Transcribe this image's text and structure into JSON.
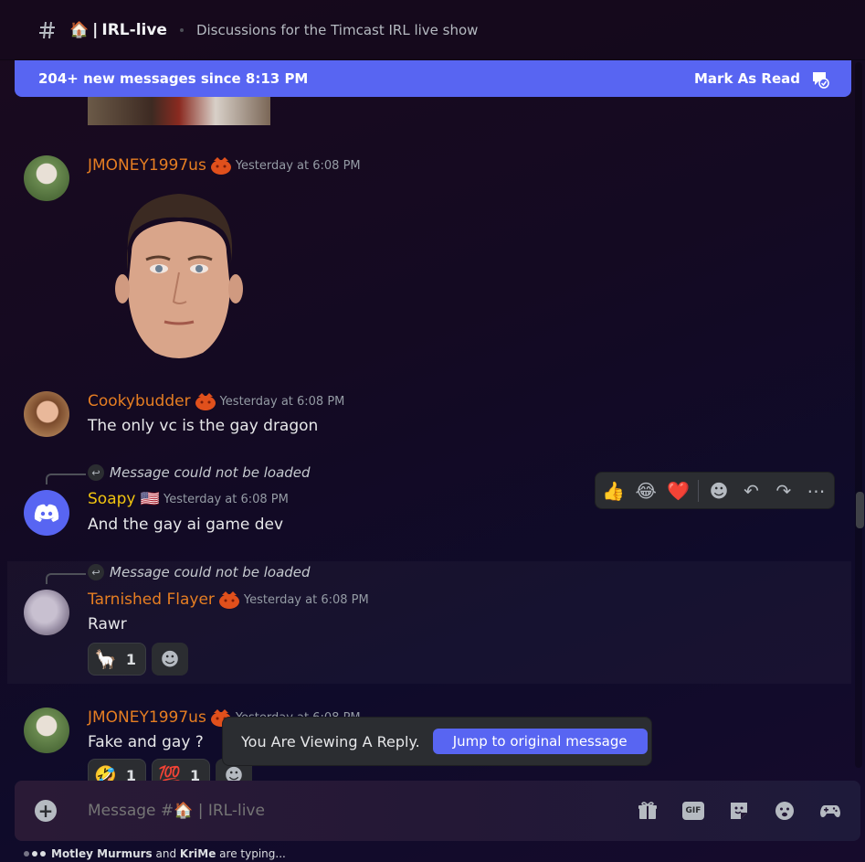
{
  "header": {
    "channel_emoji": "🏠",
    "channel_name": "IRL-live",
    "topic": "Discussions for the Timcast IRL live show"
  },
  "new_messages_bar": {
    "text": "204+ new messages since 8:13 PM",
    "mark_read_label": "Mark As Read"
  },
  "messages": [
    {
      "username": "JMONEY1997us",
      "timestamp": "Yesterday at 6:08 PM",
      "content": ""
    },
    {
      "username": "Cookybudder",
      "timestamp": "Yesterday at 6:08 PM",
      "content": "The only vc is the gay dragon"
    },
    {
      "reply_ref": "Message could not be loaded",
      "username": "Soapy",
      "flag": "🇺🇸",
      "timestamp": "Yesterday at 6:08 PM",
      "content": "And the gay ai game dev"
    },
    {
      "reply_ref": "Message could not be loaded",
      "username": "Tarnished Flayer",
      "timestamp": "Yesterday at 6:08 PM",
      "content": "Rawr",
      "reactions": [
        {
          "emoji": "🦙",
          "count": "1"
        }
      ]
    },
    {
      "username": "JMONEY1997us",
      "timestamp": "Yesterday at 6:08 PM",
      "content": "Fake and gay ?",
      "reactions": [
        {
          "emoji": "🤣",
          "count": "1"
        },
        {
          "emoji": "💯",
          "count": "1"
        }
      ]
    }
  ],
  "hover_toolbar": {
    "quick_reactions": [
      "👍",
      "😂",
      "❤️"
    ]
  },
  "viewing_reply": {
    "text": "You Are Viewing A Reply.",
    "jump_label": "Jump to original message"
  },
  "composer": {
    "placeholder": "Message #🏠 | IRL-live",
    "gif_label": "GIF"
  },
  "typing": {
    "user1": "Motley Murmurs",
    "joiner": "and",
    "user2": "KriMe",
    "suffix": "are typing..."
  },
  "colors": {
    "accent": "#5865f2",
    "username_orange": "#e67e22",
    "username_yellow": "#f1c40f"
  }
}
